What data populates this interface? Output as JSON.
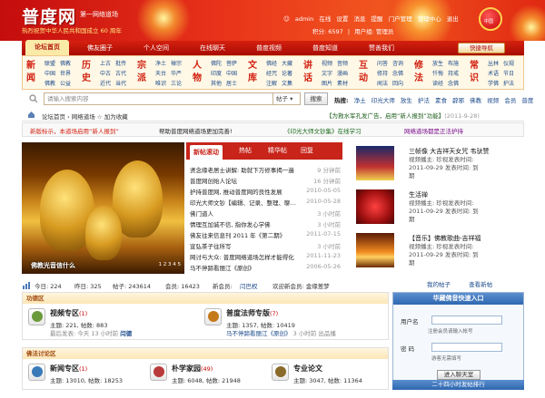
{
  "header": {
    "logo": "普度网",
    "logo_sub": "第一网络道场",
    "slogan": "热烈祝贺中华人民共和国成立 60 周年",
    "user": "admin",
    "status": "在线",
    "links": [
      "设置",
      "消息",
      "提醒",
      "门户管理",
      "管理中心",
      "退出"
    ],
    "points_label": "积分: 6597",
    "group_label": "用户组: 管理员",
    "badge_text": "中国"
  },
  "nav": {
    "items": [
      "论坛首页",
      "佛友圈子",
      "个人空间",
      "在线聊天",
      "普度视频",
      "普度知道",
      "赞善我们"
    ],
    "quicknav": "快捷导航"
  },
  "categories": [
    {
      "big": "新闻",
      "color": "#d21f0f",
      "links": [
        [
          "联盟",
          "佛教"
        ],
        [
          "中国",
          "世界"
        ],
        [
          "佛教",
          "公益"
        ]
      ]
    },
    {
      "big": "历史",
      "color": "#d21f0f",
      "links": [
        [
          "上古",
          "批传"
        ],
        [
          "中古",
          "古代"
        ],
        [
          "近代",
          "当代"
        ]
      ]
    },
    {
      "big": "宗派",
      "color": "#d21f0f",
      "links": [
        [
          "净土",
          "禅宗"
        ],
        [
          "天台",
          "华严"
        ],
        [
          "唯识",
          "三论"
        ]
      ]
    },
    {
      "big": "人物",
      "color": "#d21f0f",
      "links": [
        [
          "佛陀",
          "菩萨"
        ],
        [
          "印度",
          "中国"
        ],
        [
          "其他",
          "居士"
        ]
      ]
    },
    {
      "big": "文库",
      "color": "#d21f0f",
      "links": [
        [
          "佛经",
          "大藏"
        ],
        [
          "经咒",
          "论著"
        ],
        [
          "注解",
          "文集"
        ]
      ]
    },
    {
      "big": "讲话",
      "color": "#d21f0f",
      "links": [
        [
          "视频",
          "音频"
        ],
        [
          "文字",
          "漫画"
        ],
        [
          "图片",
          "素材"
        ]
      ]
    },
    {
      "big": "互动",
      "color": "#d21f0f",
      "links": [
        [
          "问答",
          "咨询"
        ],
        [
          "修持",
          "念佛"
        ],
        [
          "闻法",
          "回向"
        ]
      ]
    },
    {
      "big": "修法",
      "color": "#d21f0f",
      "links": [
        [
          "放生",
          "布施"
        ],
        [
          "忏悔",
          "持戒"
        ],
        [
          "读经",
          "念佛"
        ]
      ]
    },
    {
      "big": "常识",
      "color": "#d21f0f",
      "links": [
        [
          "丛林",
          "仪规"
        ],
        [
          "术语",
          "节日"
        ],
        [
          "学佛",
          "护法"
        ]
      ]
    }
  ],
  "search": {
    "placeholder": "请输入搜索内容",
    "select": "帖子",
    "button": "搜索",
    "hot_label": "热搜:",
    "hot_words": [
      "净土",
      "印光大师",
      "放生",
      "护法",
      "素食",
      "辟邪",
      "佛教",
      "视频",
      "会员",
      "普度"
    ]
  },
  "breadcrumb": {
    "text": "论坛首页  ›  网络道场  ☆ 加为收藏",
    "notice": "【为救水军孔发广告，启用“新人报到”功能】",
    "notice_date": "(2011-9-28)"
  },
  "announce": [
    {
      "text": "新版标示，本道场启用“新人报到”",
      "color": "#d21f0f"
    },
    {
      "text": "帮助普度网络道场更加完善!",
      "color": "#222"
    },
    {
      "text": "《印光大师文钞集》在线学习",
      "color": "#1a6a1a"
    },
    {
      "text": "网络道场都是正法护持"
    }
  ],
  "slide": {
    "caption": "佛教光音信什么",
    "nums": "1 2 3 4 5"
  },
  "tabs": [
    "新帖滚动",
    "热帖",
    "精华帖",
    "回复"
  ],
  "posts": [
    {
      "title": "贤念缘老居士讲解: 助就下万修事揭一遍",
      "date": "9 分钟前"
    },
    {
      "title": "普度网创始人论坛",
      "date": "16 分钟前"
    },
    {
      "title": "护持普度网, 推动普度网的良性发展",
      "date": "2010-05-05"
    },
    {
      "title": "印光大师文钞【编辑、记录、整理、聊天室】",
      "date": "2010-05-28"
    },
    {
      "title": "佛门道人",
      "date": "3 小时前"
    },
    {
      "title": "情理互加诚不信, 指你发心学佛",
      "date": "3 小时前"
    },
    {
      "title": "佛友往来信息刊 2011 年《第二期》",
      "date": "2011-07-15"
    },
    {
      "title": "宣弘茶子往所写",
      "date": "3 小时前"
    },
    {
      "title": "网讨与大众: 普度网络道场怎样才能得化",
      "date": "2011-11-23"
    },
    {
      "title": "马不停蹄看丽江《原创》",
      "date": "2006-05-26"
    }
  ],
  "videos": [
    {
      "title": "三帧像 大吉祥天女咒 韦驮赞",
      "meta": "视频播主: 珍视发表时间: 2011-09-29 发表时间: 到期"
    },
    {
      "title": "生活禅",
      "meta": "视频播主: 珍视发表时间: 2011-09-29 发表时间: 到期"
    },
    {
      "title": "【音乐】佛教歌曲-吉祥福",
      "meta": "视频播主: 珍视发表时间: 2011-09-29 发表时间: 到期"
    }
  ],
  "stats": {
    "today": "今日: 224",
    "yesterday": "昨日: 325",
    "posts": "帖子: 243614",
    "members": "会员: 16423",
    "new_member_label": "新会员:",
    "new_member": "闫巴权",
    "welcome": "欢迎新会员: 金缘葱梦",
    "links": [
      "我的帖子",
      "查看新帖"
    ]
  },
  "forum1": {
    "head": "功德区",
    "boards": [
      {
        "name": "视频专区",
        "new": "(1)",
        "stat": "主题: 221, 帖数: 883",
        "last": "最后发表: 今天 13 小时前",
        "last_by": "闫德"
      },
      {
        "name": "普度法师专版",
        "new": "(7)",
        "stat": "主题: 1357, 帖数: 10419",
        "last": "马不停蹄看丽江《原创》",
        "last_by": "3 小时前 出品播"
      }
    ]
  },
  "forum2": {
    "head": "佛法讨论区",
    "boards": [
      {
        "name": "新闻专区",
        "new": "(1)",
        "stat": "主题: 13010, 帖数: 18253"
      },
      {
        "name": "朴学家园",
        "new": "(49)",
        "stat": "主题: 6048, 帖数: 21948"
      },
      {
        "name": "专业论文",
        "new": "",
        "stat": "主题: 3047, 帖数: 11364"
      }
    ]
  },
  "login": {
    "head": "华藏佛音快速入口",
    "user_label": "用户名",
    "user_hint": "注册会员请输入帐号",
    "pass_label": "密 码",
    "pass_hint": "游客无需填写",
    "button": "进入聊天室"
  },
  "hot_head": "二十四小时发帖排行"
}
